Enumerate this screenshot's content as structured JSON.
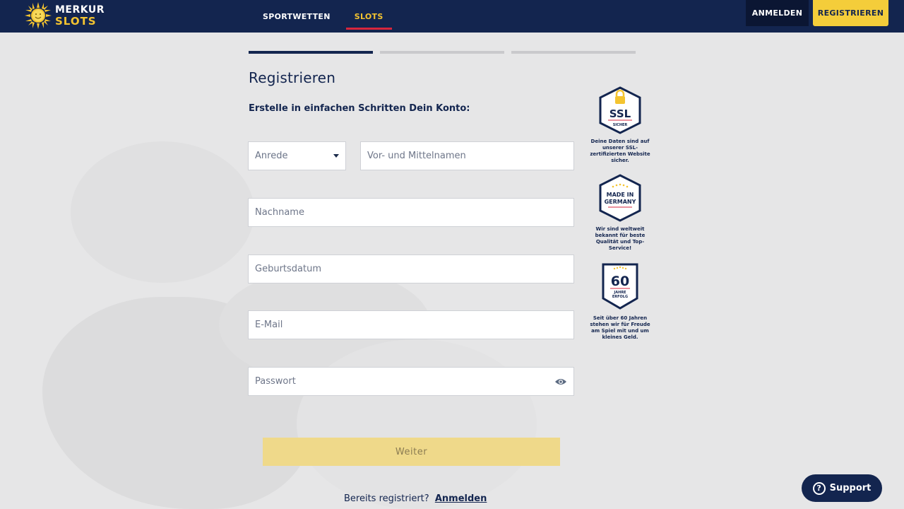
{
  "header": {
    "logo_top": "MERKUR",
    "logo_bottom": "SLOTS",
    "nav": [
      {
        "label": "SPORTWETTEN"
      },
      {
        "label": "SLOTS"
      }
    ],
    "login_label": "ANMELDEN",
    "register_label": "REGISTRIEREN"
  },
  "progress": {
    "steps": 3,
    "current": 1
  },
  "form": {
    "title": "Registrieren",
    "subtitle": "Erstelle in einfachen Schritten Dein Konto:",
    "salutation_label": "Anrede",
    "first_name_placeholder": "Vor- und Mittelnamen",
    "last_name_placeholder": "Nachname",
    "birthdate_placeholder": "Geburtsdatum",
    "email_placeholder": "E-Mail",
    "password_placeholder": "Passwort",
    "submit_label": "Weiter",
    "already_registered": "Bereits registriert?",
    "login_link": "Anmelden"
  },
  "badges": [
    {
      "badge_text": "SSL",
      "badge_sub": "SICHER",
      "caption": "Deine Daten sind auf unserer SSL-zertifizierten Website sicher."
    },
    {
      "badge_line1": "MADE IN",
      "badge_line2": "GERMANY",
      "caption": "Wir sind weltweit bekannt für beste Qualität und Top-Service!"
    },
    {
      "badge_number": "60",
      "badge_line1": "JAHRE",
      "badge_line2": "ERFOLG",
      "caption": "Seit über 60 Jahren stehen wir für Freude am Spiel mit und um kleines Geld."
    }
  ],
  "support_label": "Support",
  "support_icon_glyph": "?",
  "colors": {
    "brand_navy": "#13254f",
    "brand_yellow": "#f4cd3a",
    "accent_red": "#d7263d"
  }
}
